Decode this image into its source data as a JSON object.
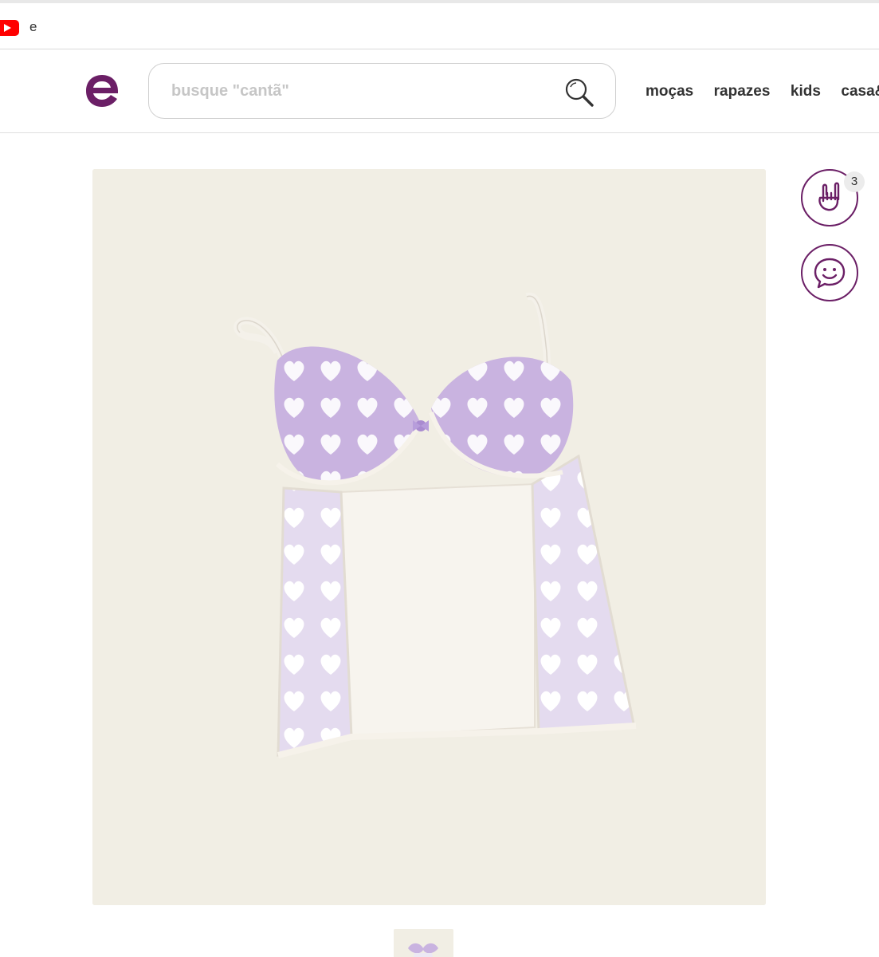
{
  "bookmarks": {
    "items": [
      {
        "icon": "youtube-icon",
        "label": "e"
      }
    ]
  },
  "header": {
    "logo_icon": "enjoei-logo-icon",
    "search": {
      "placeholder": "busque \"cantã\"",
      "value": ""
    },
    "search_icon": "magnifier-icon",
    "nav": [
      "moças",
      "rapazes",
      "kids",
      "casa&"
    ]
  },
  "product": {
    "main_image": "lilac-heart-lace-bustier-photo",
    "thumbnails": [
      "lilac-heart-lace-bustier-thumbnail"
    ],
    "actions": {
      "like_icon": "rock-hand-icon",
      "like_count": "3",
      "chat_icon": "smiley-chat-icon"
    }
  },
  "colors": {
    "brand": "#6b1f66",
    "photo_background": "#f1eee4",
    "garment_lilac": "#c9b3e0"
  }
}
